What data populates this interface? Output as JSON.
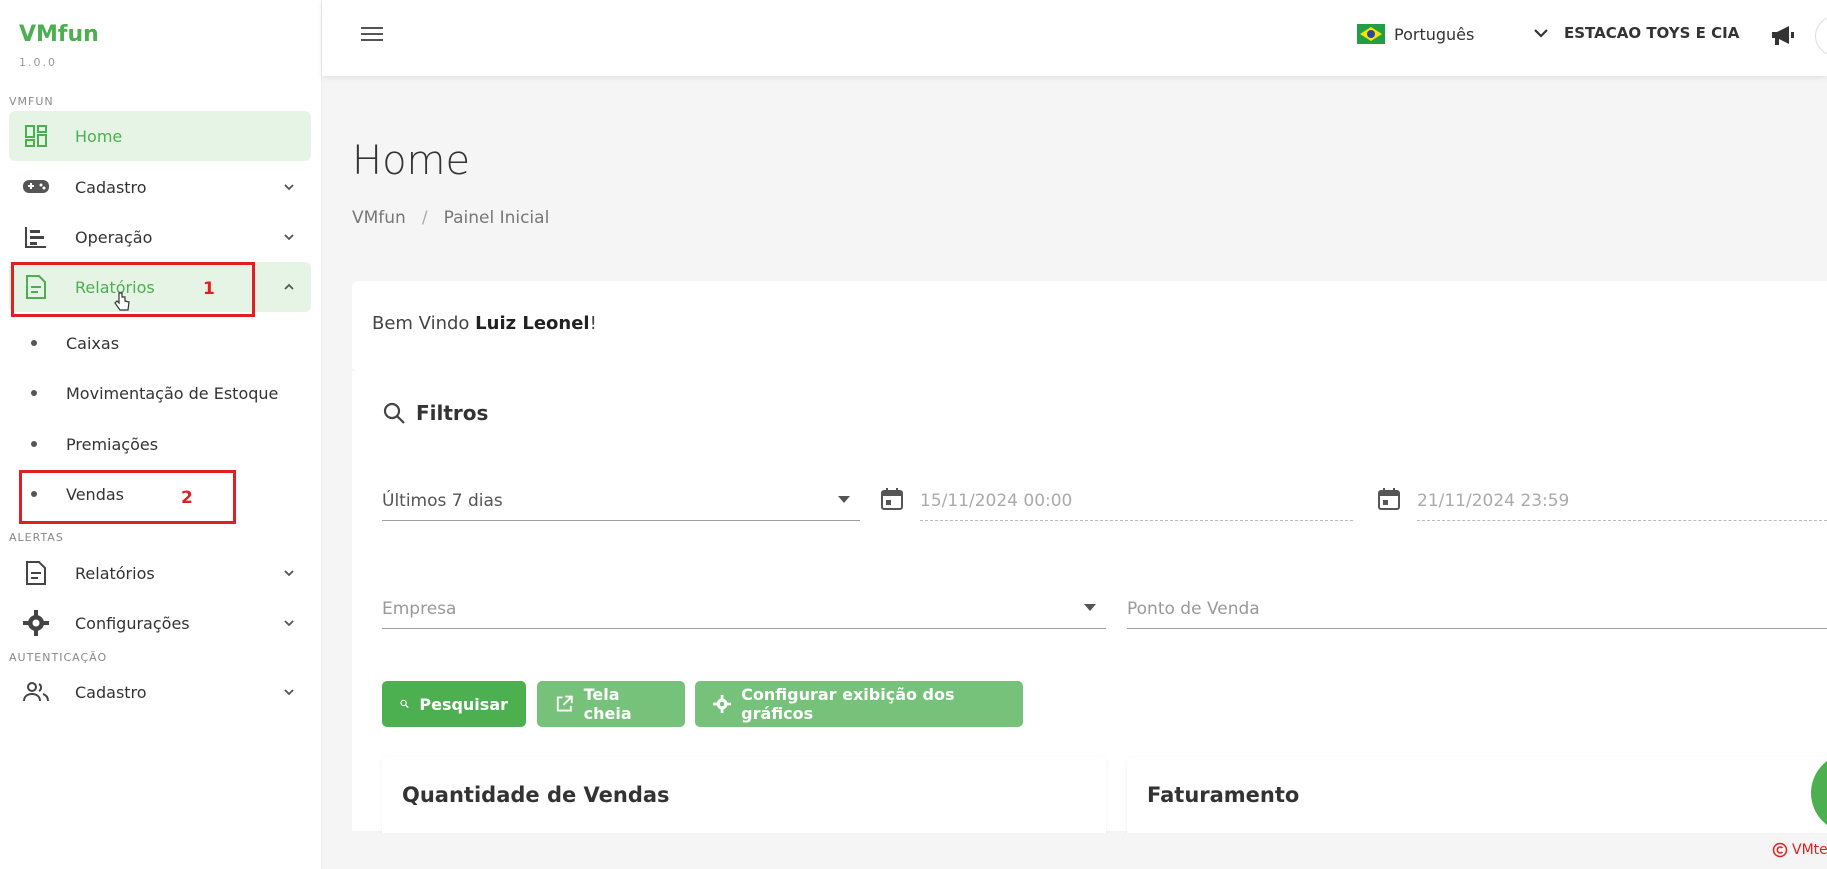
{
  "app": {
    "name": "VMfun",
    "version": "1.0.0"
  },
  "sidebar": {
    "sections": {
      "vmfun": "VMFUN",
      "alertas": "ALERTAS",
      "autenticacao": "AUTENTICAÇÃO"
    },
    "items": {
      "home": "Home",
      "cadastro": "Cadastro",
      "operacao": "Operação",
      "relatorios": "Relatórios",
      "alert_relatorios": "Relatórios",
      "configuracoes": "Configurações",
      "auth_cadastro": "Cadastro"
    },
    "subitems": [
      "Caixas",
      "Movimentação de Estoque",
      "Premiações",
      "Vendas"
    ]
  },
  "annotations": {
    "one": "1",
    "two": "2",
    "color": "#e02020"
  },
  "topbar": {
    "language": "Português",
    "company": "ESTACAO TOYS E CIA"
  },
  "page": {
    "title": "Home",
    "breadcrumb": [
      "VMfun",
      "Painel Inicial"
    ]
  },
  "welcome": {
    "prefix": "Bem Vindo ",
    "user": "Luiz Leonel",
    "suffix": "!"
  },
  "filters": {
    "title": "Filtros",
    "period": "Últimos 7 dias",
    "date_start": "15/11/2024 00:00",
    "date_end": "21/11/2024 23:59",
    "empresa_placeholder": "Empresa",
    "ponto_placeholder": "Ponto de Venda"
  },
  "buttons": {
    "search": "Pesquisar",
    "fullscreen": "Tela cheia",
    "configure": "Configurar exibição dos gráficos"
  },
  "panels": {
    "sales_qty": "Quantidade de Vendas",
    "revenue": "Faturamento"
  },
  "footer": {
    "copyright_text": "VMte"
  },
  "colors": {
    "accent": "#4caf50",
    "accent_light": "#76c27a",
    "active_bg": "#e6f4e6"
  }
}
